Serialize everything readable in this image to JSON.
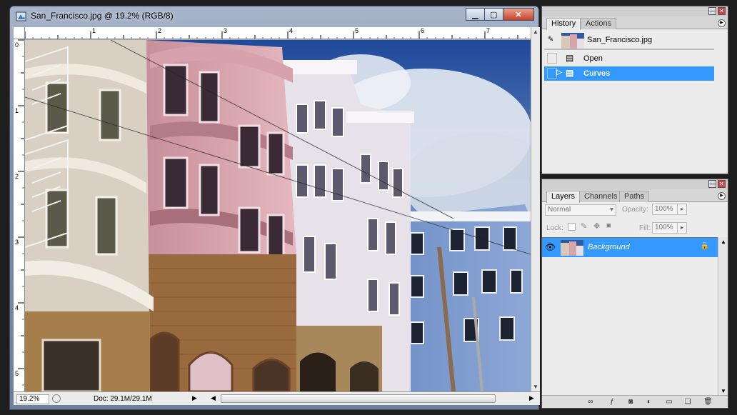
{
  "document": {
    "title": "San_Francisco.jpg @ 19.2% (RGB/8)",
    "window_buttons": {
      "minimize": "▁",
      "maximize": "▢",
      "close": "✕"
    },
    "ruler_h_labels": [
      "1",
      "2",
      "3",
      "4",
      "5",
      "6",
      "7"
    ],
    "ruler_v_labels": [
      "0",
      "1",
      "2",
      "3",
      "4",
      "5"
    ],
    "status": {
      "zoom": "19.2%",
      "doc_size": "Doc: 29.1M/29.1M"
    }
  },
  "history_panel": {
    "tabs": [
      "History",
      "Actions"
    ],
    "snapshot_label": "San_Francisco.jpg",
    "items": [
      {
        "label": "Open",
        "selected": false
      },
      {
        "label": "Curves",
        "selected": true
      }
    ]
  },
  "layers_panel": {
    "tabs": [
      "Layers",
      "Channels",
      "Paths"
    ],
    "blend_mode": "Normal",
    "opacity_label": "Opacity:",
    "opacity_value": "100%",
    "lock_label": "Lock:",
    "fill_label": "Fill:",
    "fill_value": "100%",
    "layers": [
      {
        "name": "Background",
        "selected": true,
        "visible": true,
        "locked": true
      }
    ]
  },
  "colors": {
    "accent": "#3399ff",
    "title_gradient_top": "#a8b4c8",
    "close_button": "#c7442c"
  }
}
